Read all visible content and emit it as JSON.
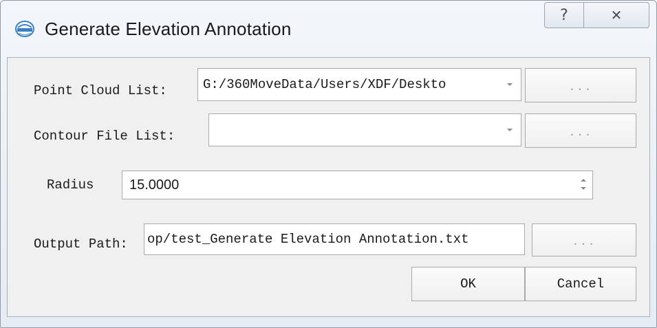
{
  "window": {
    "title": "Generate Elevation Annotation",
    "help_button": "?",
    "close_button": "✕"
  },
  "form": {
    "point_cloud": {
      "label": "Point Cloud List:",
      "value": "G:/360MoveData/Users/XDF/Deskto",
      "browse_label": "..."
    },
    "contour": {
      "label": "Contour File List:",
      "value": "",
      "browse_label": "..."
    },
    "radius": {
      "label": "Radius",
      "value": "15.0000"
    },
    "output": {
      "label": "Output Path:",
      "value": "op/test_Generate Elevation Annotation.txt",
      "browse_label": "..."
    }
  },
  "buttons": {
    "ok": "OK",
    "cancel": "Cancel"
  }
}
